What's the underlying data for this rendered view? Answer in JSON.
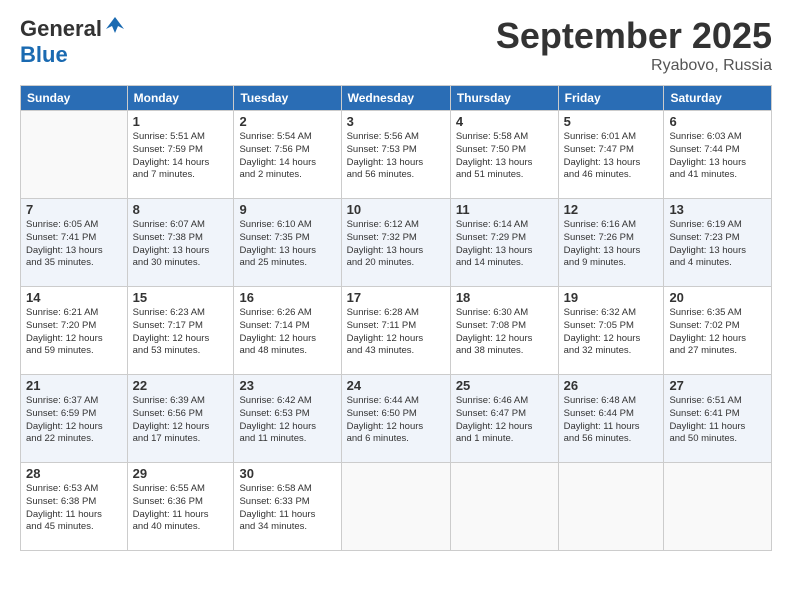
{
  "header": {
    "logo_general": "General",
    "logo_blue": "Blue",
    "month_title": "September 2025",
    "location": "Ryabovo, Russia"
  },
  "columns": [
    "Sunday",
    "Monday",
    "Tuesday",
    "Wednesday",
    "Thursday",
    "Friday",
    "Saturday"
  ],
  "weeks": [
    {
      "days": [
        {
          "num": "",
          "info": ""
        },
        {
          "num": "1",
          "info": "Sunrise: 5:51 AM\nSunset: 7:59 PM\nDaylight: 14 hours\nand 7 minutes."
        },
        {
          "num": "2",
          "info": "Sunrise: 5:54 AM\nSunset: 7:56 PM\nDaylight: 14 hours\nand 2 minutes."
        },
        {
          "num": "3",
          "info": "Sunrise: 5:56 AM\nSunset: 7:53 PM\nDaylight: 13 hours\nand 56 minutes."
        },
        {
          "num": "4",
          "info": "Sunrise: 5:58 AM\nSunset: 7:50 PM\nDaylight: 13 hours\nand 51 minutes."
        },
        {
          "num": "5",
          "info": "Sunrise: 6:01 AM\nSunset: 7:47 PM\nDaylight: 13 hours\nand 46 minutes."
        },
        {
          "num": "6",
          "info": "Sunrise: 6:03 AM\nSunset: 7:44 PM\nDaylight: 13 hours\nand 41 minutes."
        }
      ]
    },
    {
      "days": [
        {
          "num": "7",
          "info": "Sunrise: 6:05 AM\nSunset: 7:41 PM\nDaylight: 13 hours\nand 35 minutes."
        },
        {
          "num": "8",
          "info": "Sunrise: 6:07 AM\nSunset: 7:38 PM\nDaylight: 13 hours\nand 30 minutes."
        },
        {
          "num": "9",
          "info": "Sunrise: 6:10 AM\nSunset: 7:35 PM\nDaylight: 13 hours\nand 25 minutes."
        },
        {
          "num": "10",
          "info": "Sunrise: 6:12 AM\nSunset: 7:32 PM\nDaylight: 13 hours\nand 20 minutes."
        },
        {
          "num": "11",
          "info": "Sunrise: 6:14 AM\nSunset: 7:29 PM\nDaylight: 13 hours\nand 14 minutes."
        },
        {
          "num": "12",
          "info": "Sunrise: 6:16 AM\nSunset: 7:26 PM\nDaylight: 13 hours\nand 9 minutes."
        },
        {
          "num": "13",
          "info": "Sunrise: 6:19 AM\nSunset: 7:23 PM\nDaylight: 13 hours\nand 4 minutes."
        }
      ]
    },
    {
      "days": [
        {
          "num": "14",
          "info": "Sunrise: 6:21 AM\nSunset: 7:20 PM\nDaylight: 12 hours\nand 59 minutes."
        },
        {
          "num": "15",
          "info": "Sunrise: 6:23 AM\nSunset: 7:17 PM\nDaylight: 12 hours\nand 53 minutes."
        },
        {
          "num": "16",
          "info": "Sunrise: 6:26 AM\nSunset: 7:14 PM\nDaylight: 12 hours\nand 48 minutes."
        },
        {
          "num": "17",
          "info": "Sunrise: 6:28 AM\nSunset: 7:11 PM\nDaylight: 12 hours\nand 43 minutes."
        },
        {
          "num": "18",
          "info": "Sunrise: 6:30 AM\nSunset: 7:08 PM\nDaylight: 12 hours\nand 38 minutes."
        },
        {
          "num": "19",
          "info": "Sunrise: 6:32 AM\nSunset: 7:05 PM\nDaylight: 12 hours\nand 32 minutes."
        },
        {
          "num": "20",
          "info": "Sunrise: 6:35 AM\nSunset: 7:02 PM\nDaylight: 12 hours\nand 27 minutes."
        }
      ]
    },
    {
      "days": [
        {
          "num": "21",
          "info": "Sunrise: 6:37 AM\nSunset: 6:59 PM\nDaylight: 12 hours\nand 22 minutes."
        },
        {
          "num": "22",
          "info": "Sunrise: 6:39 AM\nSunset: 6:56 PM\nDaylight: 12 hours\nand 17 minutes."
        },
        {
          "num": "23",
          "info": "Sunrise: 6:42 AM\nSunset: 6:53 PM\nDaylight: 12 hours\nand 11 minutes."
        },
        {
          "num": "24",
          "info": "Sunrise: 6:44 AM\nSunset: 6:50 PM\nDaylight: 12 hours\nand 6 minutes."
        },
        {
          "num": "25",
          "info": "Sunrise: 6:46 AM\nSunset: 6:47 PM\nDaylight: 12 hours\nand 1 minute."
        },
        {
          "num": "26",
          "info": "Sunrise: 6:48 AM\nSunset: 6:44 PM\nDaylight: 11 hours\nand 56 minutes."
        },
        {
          "num": "27",
          "info": "Sunrise: 6:51 AM\nSunset: 6:41 PM\nDaylight: 11 hours\nand 50 minutes."
        }
      ]
    },
    {
      "days": [
        {
          "num": "28",
          "info": "Sunrise: 6:53 AM\nSunset: 6:38 PM\nDaylight: 11 hours\nand 45 minutes."
        },
        {
          "num": "29",
          "info": "Sunrise: 6:55 AM\nSunset: 6:36 PM\nDaylight: 11 hours\nand 40 minutes."
        },
        {
          "num": "30",
          "info": "Sunrise: 6:58 AM\nSunset: 6:33 PM\nDaylight: 11 hours\nand 34 minutes."
        },
        {
          "num": "",
          "info": ""
        },
        {
          "num": "",
          "info": ""
        },
        {
          "num": "",
          "info": ""
        },
        {
          "num": "",
          "info": ""
        }
      ]
    }
  ]
}
